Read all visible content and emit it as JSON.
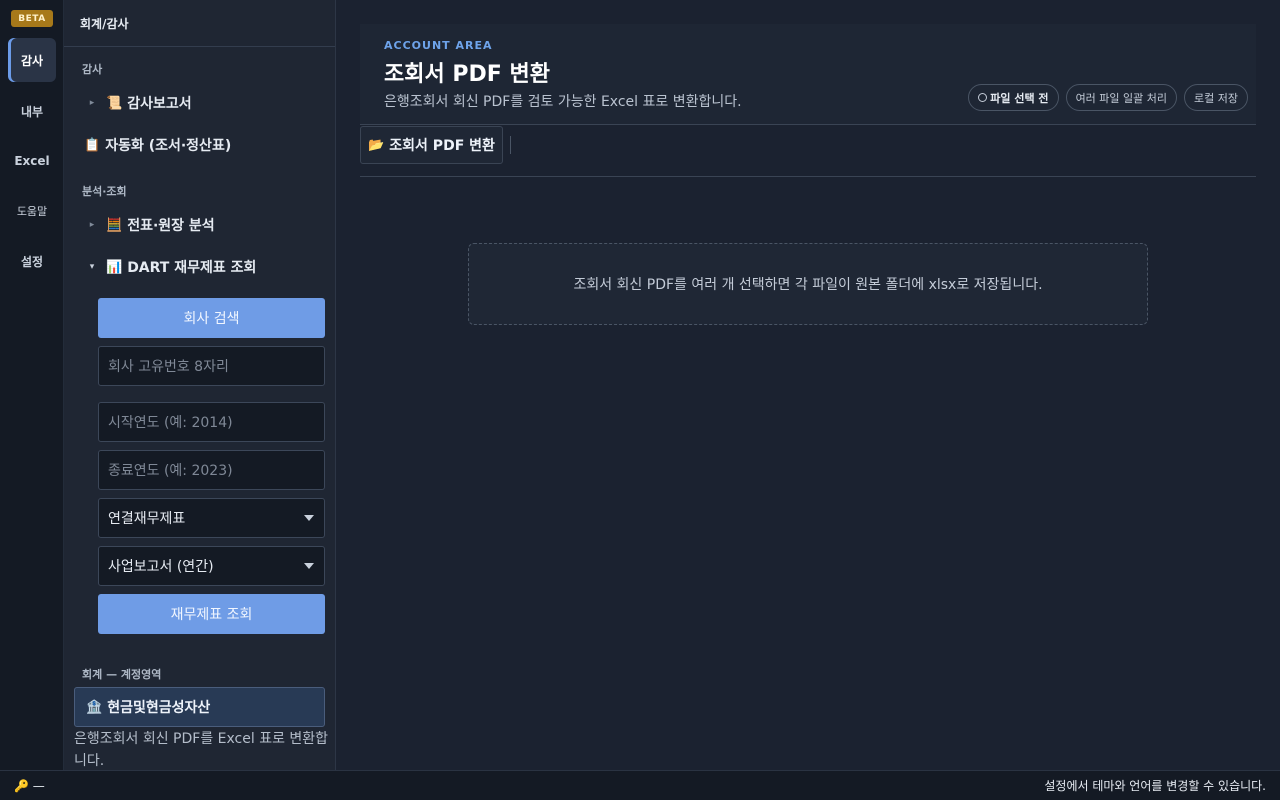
{
  "rail": {
    "badge": "BETA",
    "items": [
      "감사",
      "내부",
      "Excel",
      "도움말",
      "설정"
    ]
  },
  "sidebar": {
    "header": "회계/감사",
    "section_audit": "감사",
    "audit_report": {
      "icon": "📜",
      "label": "감사보고서"
    },
    "automation": {
      "icon": "📋",
      "label": "자동화 (조서·정산표)"
    },
    "section_analysis": "분석·조회",
    "ledger": {
      "icon": "🧮",
      "label": "전표·원장 분석"
    },
    "dart": {
      "icon": "📊",
      "label": "DART 재무제표 조회"
    },
    "dart_panel": {
      "search_button": "회사 검색",
      "corp_code_placeholder": "회사 고유번호 8자리",
      "start_year_placeholder": "시작연도 (예: 2014)",
      "end_year_placeholder": "종료연도 (예: 2023)",
      "statement_type": "연결재무제표",
      "report_type": "사업보고서 (연간)",
      "query_button": "재무제표 조회"
    },
    "section_account": "회계 — 계정영역",
    "account_card": {
      "icon": "🏦",
      "label": "현금및현금성자산"
    },
    "account_desc": "은행조회서 회신 PDF를 Excel 표로 변환합니다."
  },
  "main": {
    "kicker": "ACCOUNT AREA",
    "title": "조회서 PDF 변환",
    "subtitle": "은행조회서 회신 PDF를 검토 가능한 Excel 표로 변환합니다.",
    "chips": {
      "status": "파일 선택 전",
      "batch": "여러 파일 일괄 처리",
      "local": "로컬 저장"
    },
    "tab": {
      "icon": "📂",
      "label": "조회서 PDF 변환"
    },
    "dropzone": "조회서 회신 PDF를 여러 개 선택하면 각 파일이 원본 폴더에 xlsx로 저장됩니다."
  },
  "statusbar": {
    "key_icon": "🔑",
    "key_status": "—",
    "hint": "설정에서 테마와 언어를 변경할 수 있습니다."
  }
}
